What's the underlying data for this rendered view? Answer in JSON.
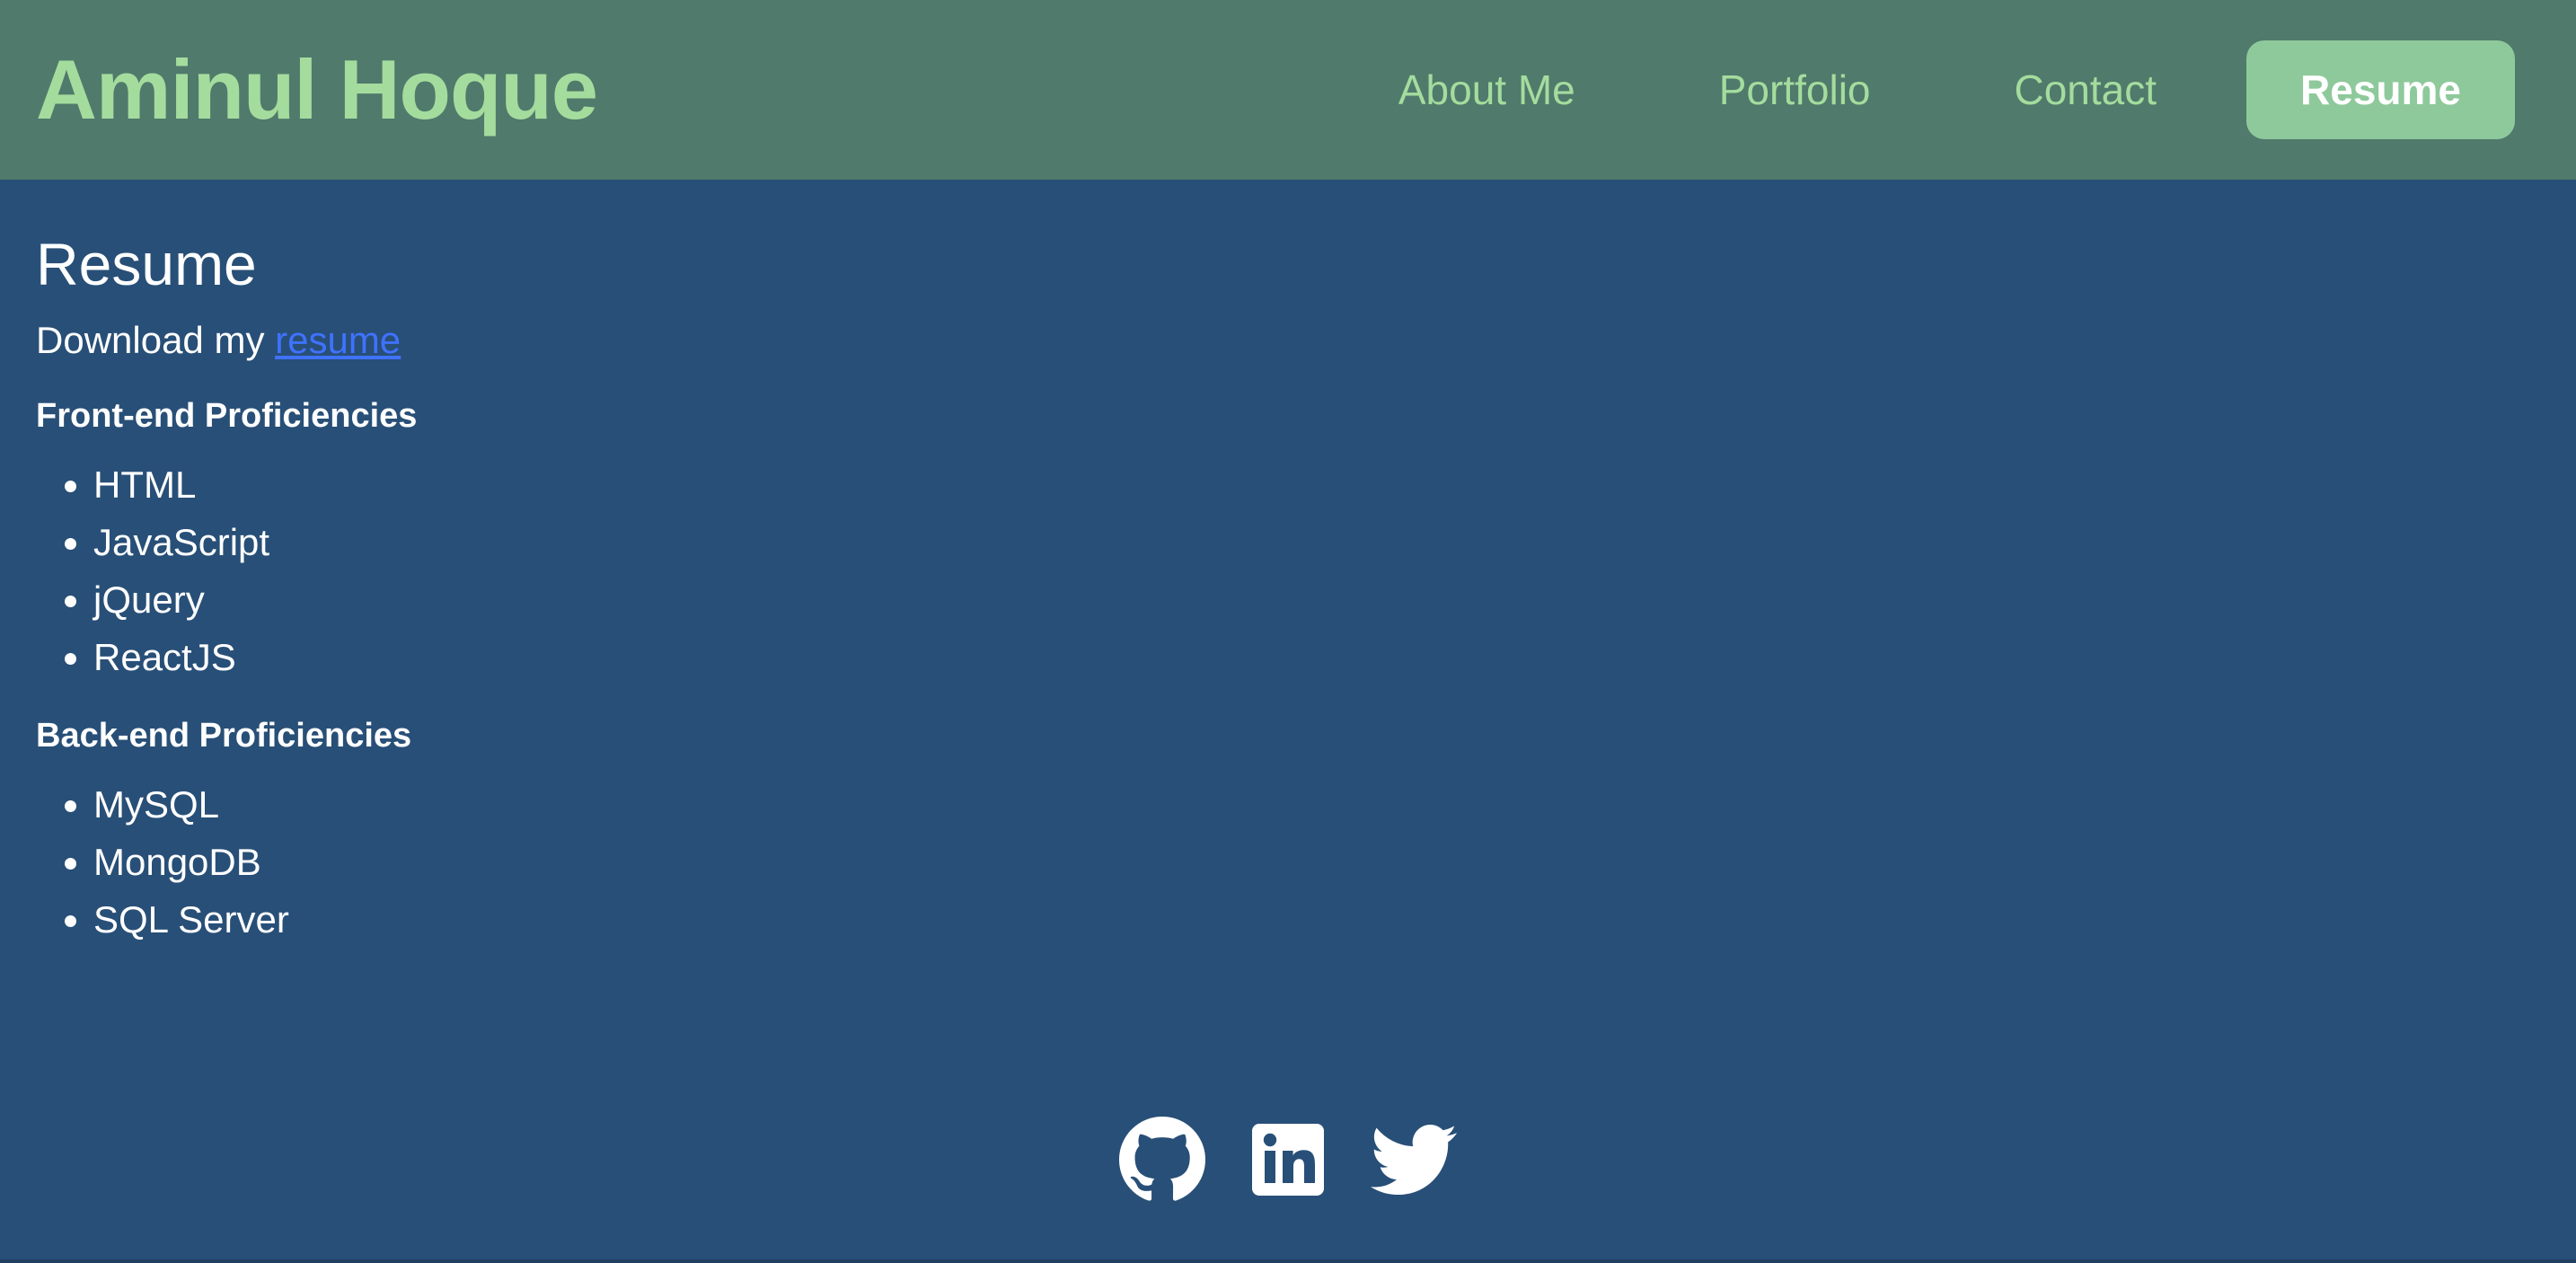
{
  "header": {
    "brand": "Aminul Hoque",
    "nav": [
      {
        "label": "About Me"
      },
      {
        "label": "Portfolio"
      },
      {
        "label": "Contact"
      },
      {
        "label": "Resume",
        "active": true
      }
    ]
  },
  "main": {
    "title": "Resume",
    "download_prefix": "Download my ",
    "download_link": "resume",
    "frontend": {
      "title": "Front-end Proficiencies",
      "items": [
        "HTML",
        "JavaScript",
        "jQuery",
        "ReactJS"
      ]
    },
    "backend": {
      "title": "Back-end Proficiencies",
      "items": [
        "MySQL",
        "MongoDB",
        "SQL Server"
      ]
    }
  },
  "footer": {
    "icons": [
      "github-icon",
      "linkedin-icon",
      "twitter-icon"
    ]
  },
  "colors": {
    "background": "#284f77",
    "header": "#507a6b",
    "brand": "#a4dc9e",
    "active_button": "#8ec99b",
    "link": "#3f72ff"
  }
}
